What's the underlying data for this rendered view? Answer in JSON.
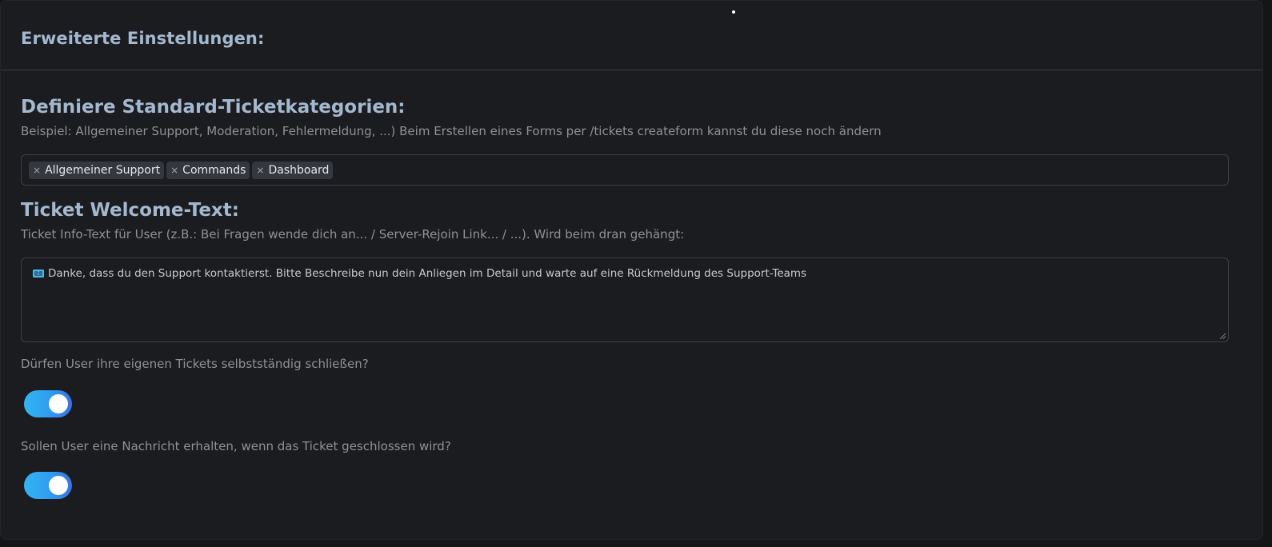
{
  "header": {
    "title": "Erweiterte Einstellungen:"
  },
  "categories": {
    "title": "Definiere Standard-Ticketkategorien:",
    "description": "Beispiel: Allgemeiner Support, Moderation, Fehlermeldung, ...) Beim Erstellen eines Forms per /tickets createform kannst du diese noch ändern",
    "remove_glyph": "×",
    "tags": [
      {
        "label": "Allgemeiner Support"
      },
      {
        "label": "Commands"
      },
      {
        "label": "Dashboard"
      }
    ]
  },
  "welcome": {
    "title": "Ticket Welcome-Text:",
    "description": "Ticket Info-Text für User (z.B.: Bei Fragen wende dich an... / Server-Rejoin Link... / ...). Wird beim dran gehängt:",
    "icon": "ticket-icon",
    "value": "Danke, dass du den Support kontaktierst. Bitte Beschreibe nun dein Anliegen im Detail und warte auf eine Rückmeldung des Support-Teams"
  },
  "settings": {
    "self_close": {
      "question": "Dürfen User ihre eigenen Tickets selbstständig schließen?",
      "enabled": true
    },
    "close_notify": {
      "question": "Sollen User eine Nachricht erhalten, wenn das Ticket geschlossen wird?",
      "enabled": true
    }
  },
  "colors": {
    "accent_start": "#32b6f3",
    "accent_end": "#3a6fe0",
    "heading": "#a4b8d0"
  }
}
